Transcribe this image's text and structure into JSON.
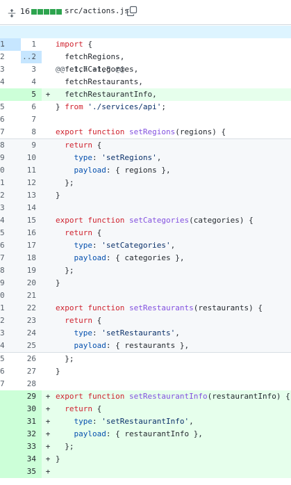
{
  "header": {
    "expand_icon": "unfold-icon",
    "change_count": "16",
    "diffstat_bars": 5,
    "filename": "src/actions.js",
    "copy_icon": "copy-icon"
  },
  "colors": {
    "addition_bg": "#e6ffec",
    "addition_gutter": "#ccffd8",
    "hunk_bg": "#ddf4ff",
    "diffstat_green": "#2da44e",
    "keyword": "#cf222e",
    "function": "#8250df",
    "string": "#0a3069",
    "property": "#0550ae"
  },
  "hunk": {
    "old_label": ".",
    "new_label": "...",
    "header": "@@ -1,7 +1,8 @@"
  },
  "lines": [
    {
      "old": "1",
      "new": "1",
      "sign": "",
      "type": "ctx",
      "tokens": [
        [
          "k",
          "import"
        ],
        [
          "t",
          " {"
        ]
      ]
    },
    {
      "old": "2",
      "new": "2",
      "sign": "",
      "type": "ctx",
      "tokens": [
        [
          "t",
          "  fetchRegions,"
        ]
      ]
    },
    {
      "old": "3",
      "new": "3",
      "sign": "",
      "type": "ctx",
      "tokens": [
        [
          "t",
          "  fetchCategories,"
        ]
      ]
    },
    {
      "old": "4",
      "new": "4",
      "sign": "",
      "type": "ctx",
      "tokens": [
        [
          "t",
          "  fetchRestaurants,"
        ]
      ]
    },
    {
      "old": "",
      "new": "5",
      "sign": "+",
      "type": "add",
      "tokens": [
        [
          "t",
          "  fetchRestaurantInfo,"
        ]
      ]
    },
    {
      "old": "5",
      "new": "6",
      "sign": "",
      "type": "ctx",
      "tokens": [
        [
          "t",
          "} "
        ],
        [
          "k",
          "from"
        ],
        [
          "t",
          " "
        ],
        [
          "s",
          "'./services/api'"
        ],
        [
          "t",
          ";"
        ]
      ]
    },
    {
      "old": "6",
      "new": "7",
      "sign": "",
      "type": "ctx",
      "tokens": []
    },
    {
      "old": "7",
      "new": "8",
      "sign": "",
      "type": "ctx",
      "tokens": [
        [
          "k",
          "export"
        ],
        [
          "t",
          " "
        ],
        [
          "k",
          "function"
        ],
        [
          "t",
          " "
        ],
        [
          "f",
          "setRegions"
        ],
        [
          "t",
          "(regions) {"
        ]
      ]
    },
    {
      "old": "8",
      "new": "9",
      "sign": "",
      "type": "gray",
      "tokens": [
        [
          "t",
          "  "
        ],
        [
          "k",
          "return"
        ],
        [
          "t",
          " {"
        ]
      ]
    },
    {
      "old": "9",
      "new": "10",
      "sign": "",
      "type": "gray",
      "tokens": [
        [
          "t",
          "    "
        ],
        [
          "p",
          "type"
        ],
        [
          "t",
          ": "
        ],
        [
          "s",
          "'setRegions'"
        ],
        [
          "t",
          ","
        ]
      ]
    },
    {
      "old": "0",
      "new": "11",
      "sign": "",
      "type": "gray",
      "tokens": [
        [
          "t",
          "    "
        ],
        [
          "p",
          "payload"
        ],
        [
          "t",
          ": { regions },"
        ]
      ]
    },
    {
      "old": "1",
      "new": "12",
      "sign": "",
      "type": "gray",
      "tokens": [
        [
          "t",
          "  };"
        ]
      ]
    },
    {
      "old": "2",
      "new": "13",
      "sign": "",
      "type": "gray",
      "tokens": [
        [
          "t",
          "}"
        ]
      ]
    },
    {
      "old": "3",
      "new": "14",
      "sign": "",
      "type": "gray",
      "tokens": []
    },
    {
      "old": "4",
      "new": "15",
      "sign": "",
      "type": "gray",
      "tokens": [
        [
          "k",
          "export"
        ],
        [
          "t",
          " "
        ],
        [
          "k",
          "function"
        ],
        [
          "t",
          " "
        ],
        [
          "f",
          "setCategories"
        ],
        [
          "t",
          "(categories) {"
        ]
      ]
    },
    {
      "old": "5",
      "new": "16",
      "sign": "",
      "type": "gray",
      "tokens": [
        [
          "t",
          "  "
        ],
        [
          "k",
          "return"
        ],
        [
          "t",
          " {"
        ]
      ]
    },
    {
      "old": "6",
      "new": "17",
      "sign": "",
      "type": "gray",
      "tokens": [
        [
          "t",
          "    "
        ],
        [
          "p",
          "type"
        ],
        [
          "t",
          ": "
        ],
        [
          "s",
          "'setCategories'"
        ],
        [
          "t",
          ","
        ]
      ]
    },
    {
      "old": "7",
      "new": "18",
      "sign": "",
      "type": "gray",
      "tokens": [
        [
          "t",
          "    "
        ],
        [
          "p",
          "payload"
        ],
        [
          "t",
          ": { categories },"
        ]
      ]
    },
    {
      "old": "8",
      "new": "19",
      "sign": "",
      "type": "gray",
      "tokens": [
        [
          "t",
          "  };"
        ]
      ]
    },
    {
      "old": "9",
      "new": "20",
      "sign": "",
      "type": "gray",
      "tokens": [
        [
          "t",
          "}"
        ]
      ]
    },
    {
      "old": "0",
      "new": "21",
      "sign": "",
      "type": "gray",
      "tokens": []
    },
    {
      "old": "1",
      "new": "22",
      "sign": "",
      "type": "gray",
      "tokens": [
        [
          "k",
          "export"
        ],
        [
          "t",
          " "
        ],
        [
          "k",
          "function"
        ],
        [
          "t",
          " "
        ],
        [
          "f",
          "setRestaurants"
        ],
        [
          "t",
          "(restaurants) {"
        ]
      ]
    },
    {
      "old": "2",
      "new": "23",
      "sign": "",
      "type": "gray",
      "tokens": [
        [
          "t",
          "  "
        ],
        [
          "k",
          "return"
        ],
        [
          "t",
          " {"
        ]
      ]
    },
    {
      "old": "3",
      "new": "24",
      "sign": "",
      "type": "gray",
      "tokens": [
        [
          "t",
          "    "
        ],
        [
          "p",
          "type"
        ],
        [
          "t",
          ": "
        ],
        [
          "s",
          "'setRestaurants'"
        ],
        [
          "t",
          ","
        ]
      ]
    },
    {
      "old": "4",
      "new": "25",
      "sign": "",
      "type": "gray",
      "tokens": [
        [
          "t",
          "    "
        ],
        [
          "p",
          "payload"
        ],
        [
          "t",
          ": { restaurants },"
        ]
      ]
    },
    {
      "old": "5",
      "new": "26",
      "sign": "",
      "type": "ctx",
      "tokens": [
        [
          "t",
          "  };"
        ]
      ]
    },
    {
      "old": "6",
      "new": "27",
      "sign": "",
      "type": "ctx",
      "tokens": [
        [
          "t",
          "}"
        ]
      ]
    },
    {
      "old": "7",
      "new": "28",
      "sign": "",
      "type": "ctx",
      "tokens": []
    },
    {
      "old": "",
      "new": "29",
      "sign": "+",
      "type": "add",
      "tokens": [
        [
          "k",
          "export"
        ],
        [
          "t",
          " "
        ],
        [
          "k",
          "function"
        ],
        [
          "t",
          " "
        ],
        [
          "f",
          "setRestaurantInfo"
        ],
        [
          "t",
          "(restaurantInfo) {"
        ]
      ]
    },
    {
      "old": "",
      "new": "30",
      "sign": "+",
      "type": "add",
      "tokens": [
        [
          "t",
          "  "
        ],
        [
          "k",
          "return"
        ],
        [
          "t",
          " {"
        ]
      ]
    },
    {
      "old": "",
      "new": "31",
      "sign": "+",
      "type": "add",
      "tokens": [
        [
          "t",
          "    "
        ],
        [
          "p",
          "type"
        ],
        [
          "t",
          ": "
        ],
        [
          "s",
          "'setRestaurantInfo'"
        ],
        [
          "t",
          ","
        ]
      ]
    },
    {
      "old": "",
      "new": "32",
      "sign": "+",
      "type": "add",
      "tokens": [
        [
          "t",
          "    "
        ],
        [
          "p",
          "payload"
        ],
        [
          "t",
          ": { restaurantInfo },"
        ]
      ]
    },
    {
      "old": "",
      "new": "33",
      "sign": "+",
      "type": "add",
      "tokens": [
        [
          "t",
          "  };"
        ]
      ]
    },
    {
      "old": "",
      "new": "34",
      "sign": "+",
      "type": "add",
      "tokens": [
        [
          "t",
          "}"
        ]
      ]
    },
    {
      "old": "",
      "new": "35",
      "sign": "+",
      "type": "add",
      "tokens": []
    }
  ]
}
